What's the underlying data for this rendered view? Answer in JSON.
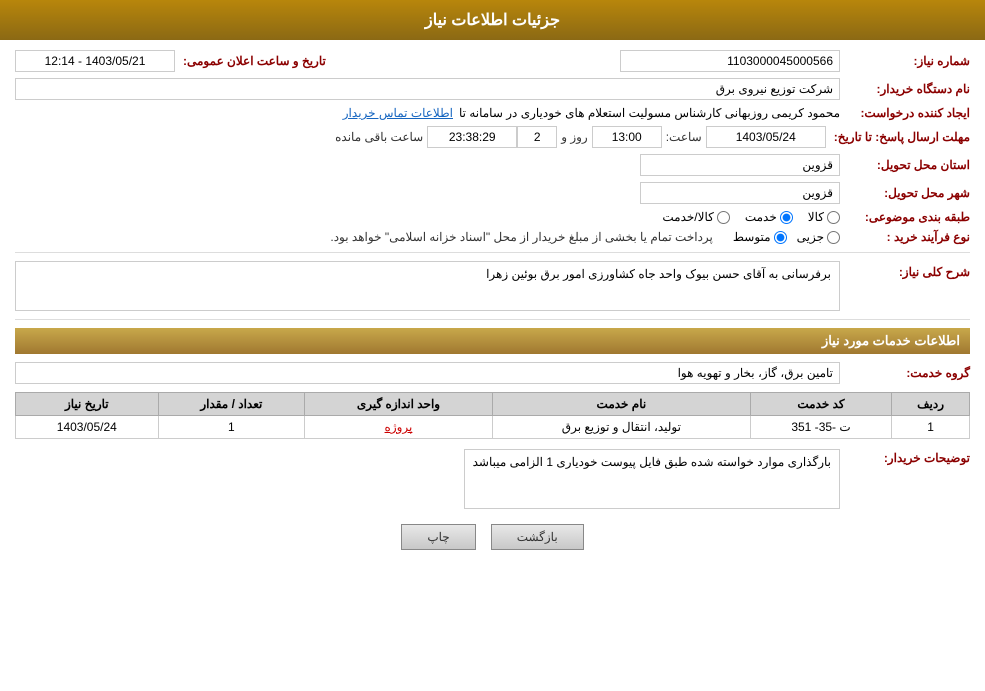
{
  "header": {
    "title": "جزئیات اطلاعات نیاز"
  },
  "form": {
    "shomareNiaz_label": "شماره نیاز:",
    "shomareNiaz_value": "1103000045000566",
    "namDastgah_label": "نام دستگاه خریدار:",
    "namDastgah_value": "شرکت توزیع نیروی برق",
    "ijadKonande_label": "ایجاد کننده درخواست:",
    "ijadKonande_value": "محمود کریمی روزبهانی کارشناس  مسولیت استعلام های خودیاری در سامانه تا",
    "ettelaatTamas_label": "اطلاعات تماس خریدار",
    "mohlatErsalPasokh_label": "مهلت ارسال پاسخ: تا تاریخ:",
    "mohlatDate": "1403/05/24",
    "mohlatTime_label": "ساعت:",
    "mohlatTime": "13:00",
    "mohlatRooz_label": "روز و",
    "mohlatRooz": "2",
    "baghiMande_label": "ساعت باقی مانده",
    "baghiMande": "23:38:29",
    "ostan_label": "استان محل تحویل:",
    "ostan_value": "قزوین",
    "shahr_label": "شهر محل تحویل:",
    "shahr_value": "قزوین",
    "tabaqeBandi_label": "طبقه بندی موضوعی:",
    "tabaqe_kala_label": "کالا",
    "tabaqe_khedmat_label": "خدمت",
    "tabaqe_kalaKhedmat_label": "کالا/خدمت",
    "tabaqe_selected": "khedmat",
    "noFarayandKharid_label": "نوع فرآیند خرید :",
    "jozi_label": "جزیی",
    "motavaset_label": "متوسط",
    "pardakht_label": "پرداخت تمام یا بخشی از مبلغ خریدار از محل \"اسناد خزانه اسلامی\" خواهد بود.",
    "sharhKoli_label": "شرح کلی نیاز:",
    "sharhKoli_value": "برفرسانی به آقای حسن بیوک واحد جاه کشاورزی امور برق بوئین زهرا",
    "khadamat_section_header": "اطلاعات خدمات مورد نیاز",
    "groheKhedmat_label": "گروه خدمت:",
    "groheKhedmat_value": "تامین برق، گاز، بخار و تهویه هوا",
    "table": {
      "headers": [
        "ردیف",
        "کد خدمت",
        "نام خدمت",
        "واحد اندازه گیری",
        "تعداد / مقدار",
        "تاریخ نیاز"
      ],
      "rows": [
        {
          "radif": "1",
          "kodKhedmat": "ت -35- 351",
          "namKhedmat": "تولید، انتقال و توزیع برق",
          "vahed": "پروژه",
          "tedad": "1",
          "tarikh": "1403/05/24"
        }
      ]
    },
    "tawzihat_label": "توضیحات خریدار:",
    "tawzihat_value": "بارگذاری موارد خواسته شده طبق فایل پیوست خودیاری 1 الزامی میباشد",
    "tarikh_label": "تاریخ و ساعت اعلان عمومی:",
    "tarikh_value": "1403/05/21 - 12:14",
    "btn_print": "چاپ",
    "btn_back": "بازگشت"
  }
}
